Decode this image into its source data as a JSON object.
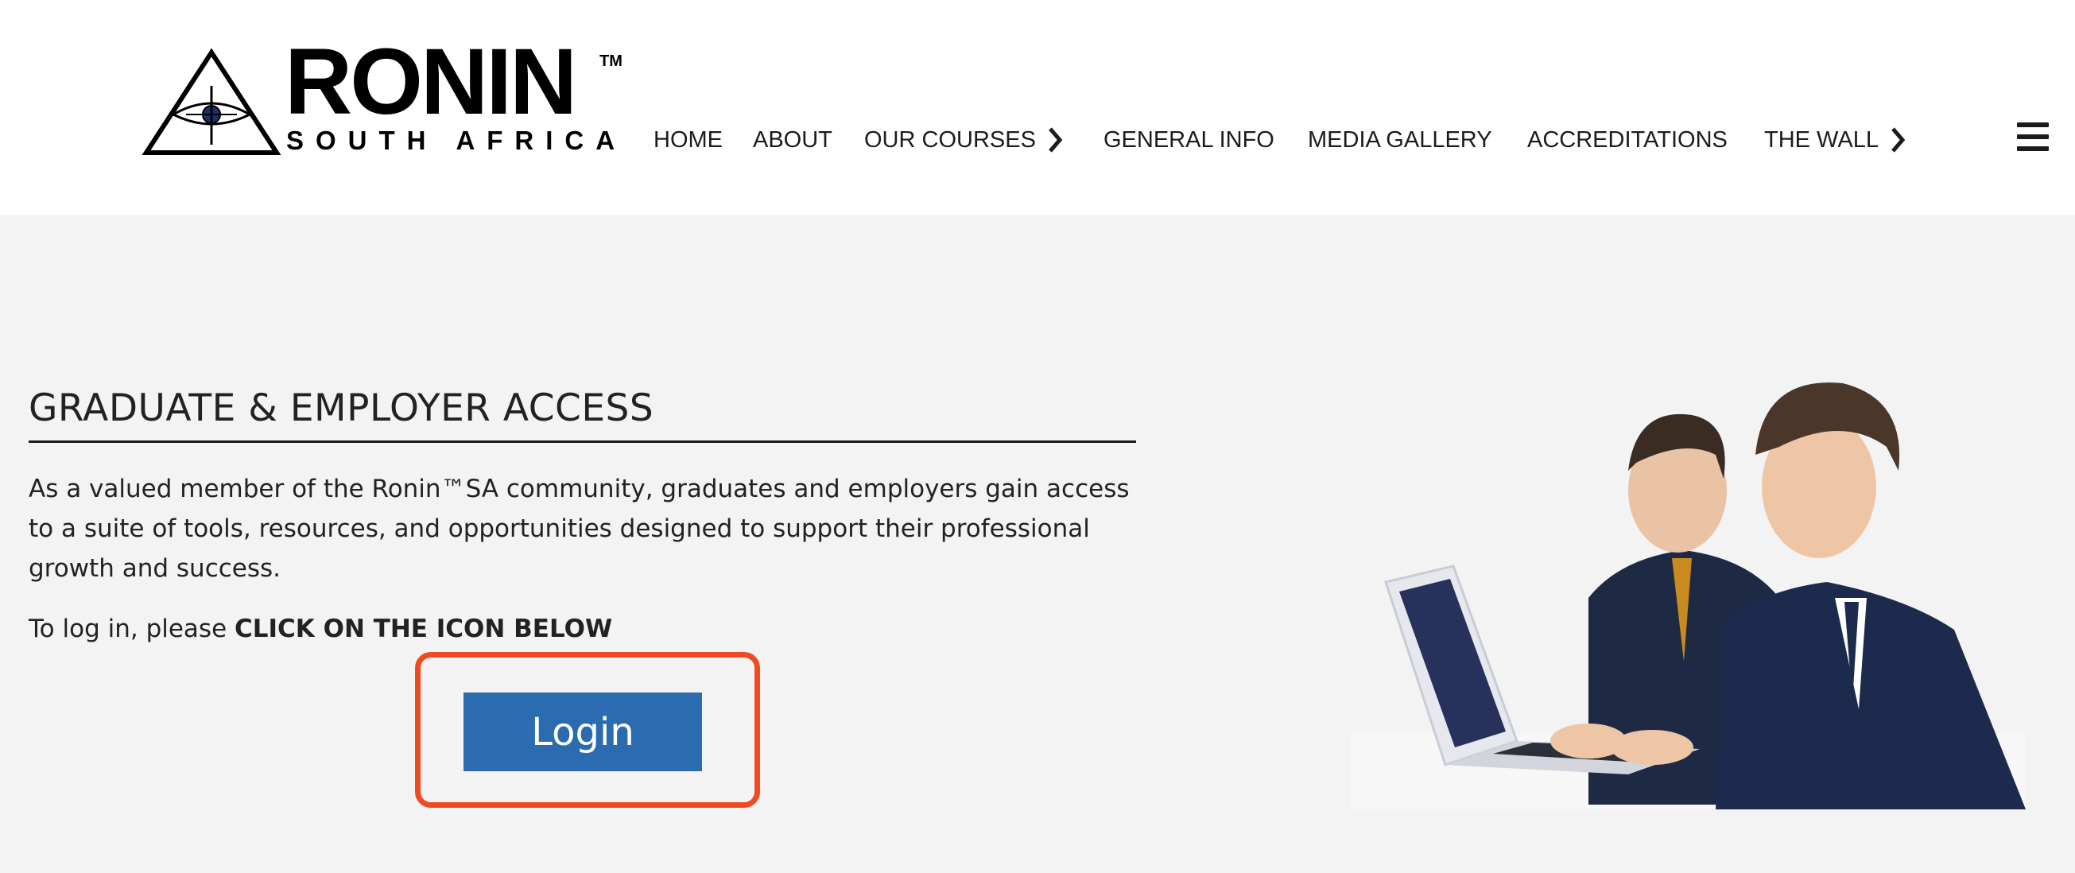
{
  "brand": {
    "name": "RONIN",
    "trademark": "TM",
    "tagline": "SOUTH AFRICA"
  },
  "nav": {
    "items": [
      {
        "label": "HOME",
        "has_submenu": false
      },
      {
        "label": "ABOUT",
        "has_submenu": false
      },
      {
        "label": "OUR COURSES",
        "has_submenu": true
      },
      {
        "label": "GENERAL INFO",
        "has_submenu": false
      },
      {
        "label": "MEDIA GALLERY",
        "has_submenu": false
      },
      {
        "label": "ACCREDITATIONS",
        "has_submenu": false
      },
      {
        "label": "THE WALL",
        "has_submenu": true
      }
    ],
    "menu_icon": "hamburger-menu-icon"
  },
  "main": {
    "title": "GRADUATE & EMPLOYER ACCESS",
    "intro": "As a valued member of the Ronin™SA community, graduates and employers gain access to a suite of tools, resources, and opportunities designed to support their professional growth and success.",
    "login_note_prefix": "To log in, please ",
    "login_note_bold": "CLICK ON THE ICON BELOW",
    "login_button": "Login"
  },
  "colors": {
    "header_bg": "#ffffff",
    "page_bg": "#f3f3f3",
    "button_bg": "#2b6cb0",
    "highlight": "#f04a22"
  },
  "icons": {
    "chevron": "chevron-right-icon",
    "logo_mark": "eye-triangle-icon"
  }
}
